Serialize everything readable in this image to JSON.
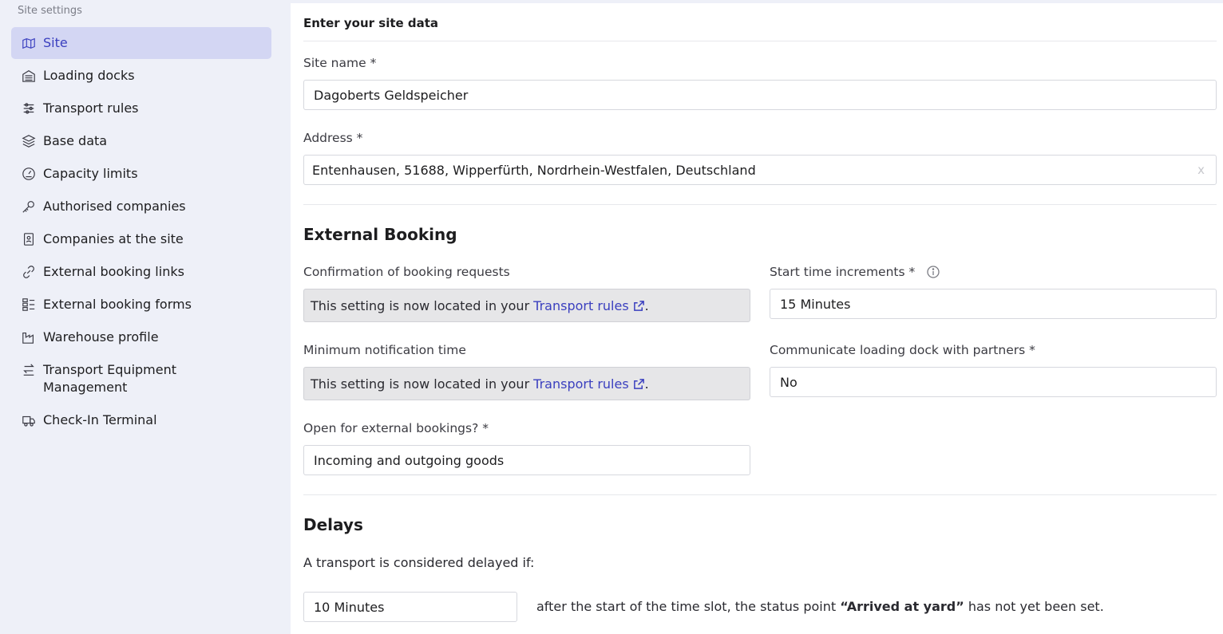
{
  "sidebar": {
    "heading": "Site settings",
    "items": [
      {
        "label": "Site",
        "icon": "map-icon"
      },
      {
        "label": "Loading docks",
        "icon": "warehouse-icon"
      },
      {
        "label": "Transport rules",
        "icon": "sliders-icon"
      },
      {
        "label": "Base data",
        "icon": "layers-icon"
      },
      {
        "label": "Capacity limits",
        "icon": "gauge-icon"
      },
      {
        "label": "Authorised companies",
        "icon": "key-icon"
      },
      {
        "label": "Companies at the site",
        "icon": "contact-icon"
      },
      {
        "label": "External booking links",
        "icon": "link-icon"
      },
      {
        "label": "External booking forms",
        "icon": "grid-icon"
      },
      {
        "label": "Warehouse profile",
        "icon": "factory-icon"
      },
      {
        "label": "Transport Equipment Management",
        "icon": "transfer-icon"
      },
      {
        "label": "Check-In Terminal",
        "icon": "truck-icon"
      }
    ]
  },
  "site_data": {
    "title": "Enter your site data",
    "site_name_label": "Site name *",
    "site_name_value": "Dagoberts Geldspeicher",
    "address_label": "Address *",
    "address_value": "Entenhausen, 51688, Wipperfürth, Nordrhein-Westfalen, Deutschland",
    "clear_symbol": "x"
  },
  "external_booking": {
    "title": "External Booking",
    "confirmation_label": "Confirmation of booking requests",
    "confirmation_text": "This setting is now located in your",
    "confirmation_link": "Transport rules",
    "min_notification_label": "Minimum notification time",
    "min_notification_text": "This setting is now located in your",
    "min_notification_link": "Transport rules",
    "period": ".",
    "start_time_label": "Start time increments *",
    "start_time_value": "15 Minutes",
    "communicate_label": "Communicate loading dock with partners *",
    "communicate_value": "No",
    "open_label": "Open for external bookings? *",
    "open_value": "Incoming and outgoing goods"
  },
  "delays": {
    "title": "Delays",
    "intro": "A transport is considered delayed if:",
    "delay_value": "10 Minutes",
    "text_before": "after the start of the time slot, the status point",
    "status_point": "“Arrived at yard”",
    "text_after": "has not yet been set."
  },
  "colors": {
    "accent": "#3a3fbf",
    "active_bg": "#d3d6f3",
    "sidebar_bg": "#eef0f8",
    "info_box_bg": "#e6e6e8"
  }
}
